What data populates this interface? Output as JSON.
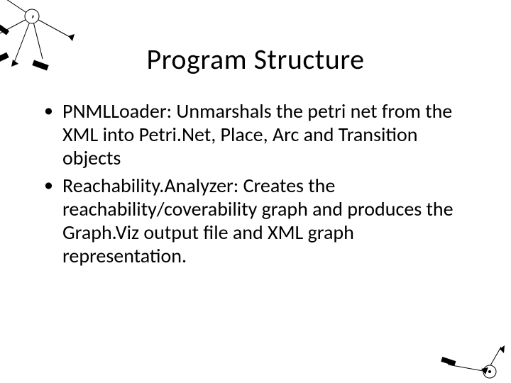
{
  "title": "Program Structure",
  "bullets": [
    "PNMLLoader: Unmarshals the petri net from the XML into Petri.Net, Place, Arc and Transition objects",
    "Reachability.Analyzer: Creates the reachability/coverability graph and produces the Graph.Viz output file and XML graph representation."
  ]
}
